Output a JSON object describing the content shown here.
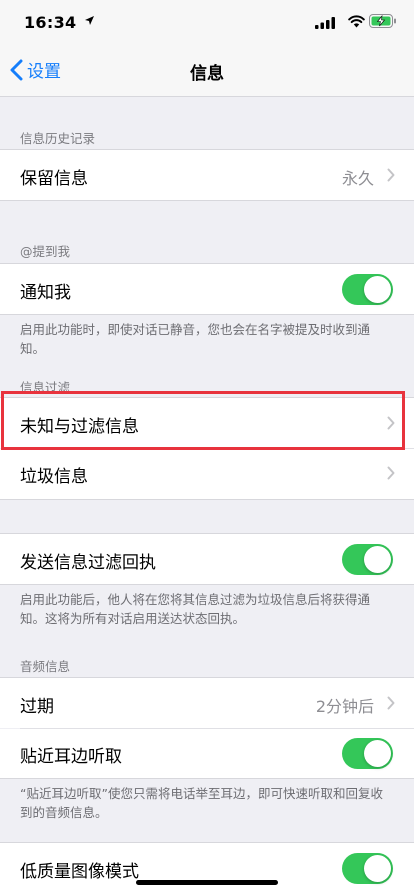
{
  "status": {
    "time": "16:34"
  },
  "nav": {
    "back_label": "设置",
    "title": "信息"
  },
  "sections": {
    "history_header": "信息历史记录",
    "keep_messages": {
      "label": "保留信息",
      "value": "永久"
    },
    "mention_header": "@提到我",
    "notify_me": {
      "label": "通知我",
      "on": true
    },
    "notify_footer": "启用此功能时，即使对话已静音，您也会在名字被提及时收到通知。",
    "filter_header": "信息过滤",
    "unknown_filter": {
      "label": "未知与过滤信息"
    },
    "junk": {
      "label": "垃圾信息"
    },
    "send_receipt": {
      "label": "发送信息过滤回执",
      "on": true
    },
    "receipt_footer": "启用此功能后，他人将在您将其信息过滤为垃圾信息后将获得通知。这将为所有对话启用送达状态回执。",
    "audio_header": "音频信息",
    "expire": {
      "label": "过期",
      "value": "2分钟后"
    },
    "raise_listen": {
      "label": "贴近耳边听取",
      "on": true
    },
    "raise_footer": "“贴近耳边听取”使您只需将电话举至耳边，即可快速听取和回复收到的音频信息。",
    "low_quality": {
      "label": "低质量图像模式",
      "on": true
    }
  },
  "colors": {
    "accent": "#157efb",
    "toggle_on": "#34c759",
    "highlight": "#e8333d"
  },
  "icons": [
    "location-arrow-icon",
    "signal-icon",
    "wifi-icon",
    "battery-charging-icon",
    "chevron-left-icon",
    "chevron-right-icon"
  ]
}
